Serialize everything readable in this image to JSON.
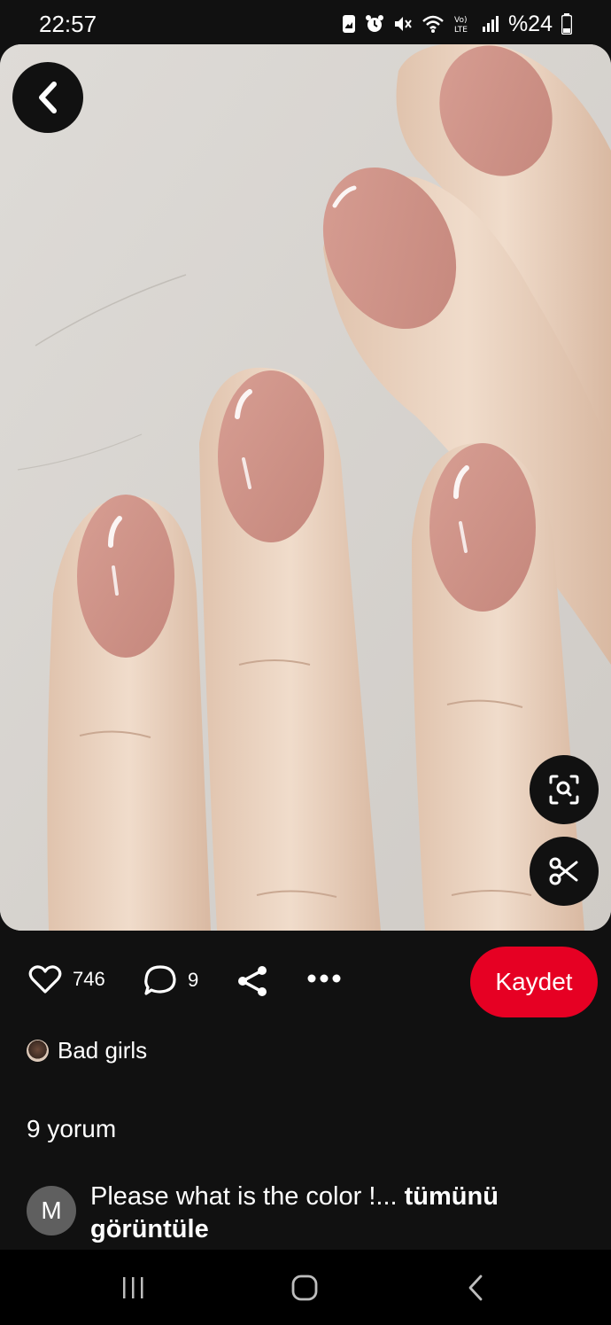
{
  "status_bar": {
    "time": "22:57",
    "battery": "%24",
    "icons": [
      "photo-icon",
      "alarm-icon",
      "mute-icon",
      "wifi-icon",
      "volte-icon",
      "signal-icon",
      "battery-icon"
    ]
  },
  "pin": {
    "image_description_icon": "nail-polish-photo",
    "back_icon": "chevron-left-icon",
    "visual_search_icon": "visual-search-icon",
    "cutout_icon": "scissors-icon"
  },
  "actions": {
    "like_count": "746",
    "comment_count": "9",
    "save_label": "Kaydet",
    "save_color": "#e60023"
  },
  "board": {
    "name": "Bad girls"
  },
  "comments": {
    "title": "9 yorum",
    "items": [
      {
        "avatar_letter": "M",
        "text": "Please what is the color !...",
        "more_label": "tümünü görüntüle"
      }
    ]
  },
  "nav": {
    "icons": [
      "recent-apps-icon",
      "home-icon",
      "back-icon"
    ]
  }
}
